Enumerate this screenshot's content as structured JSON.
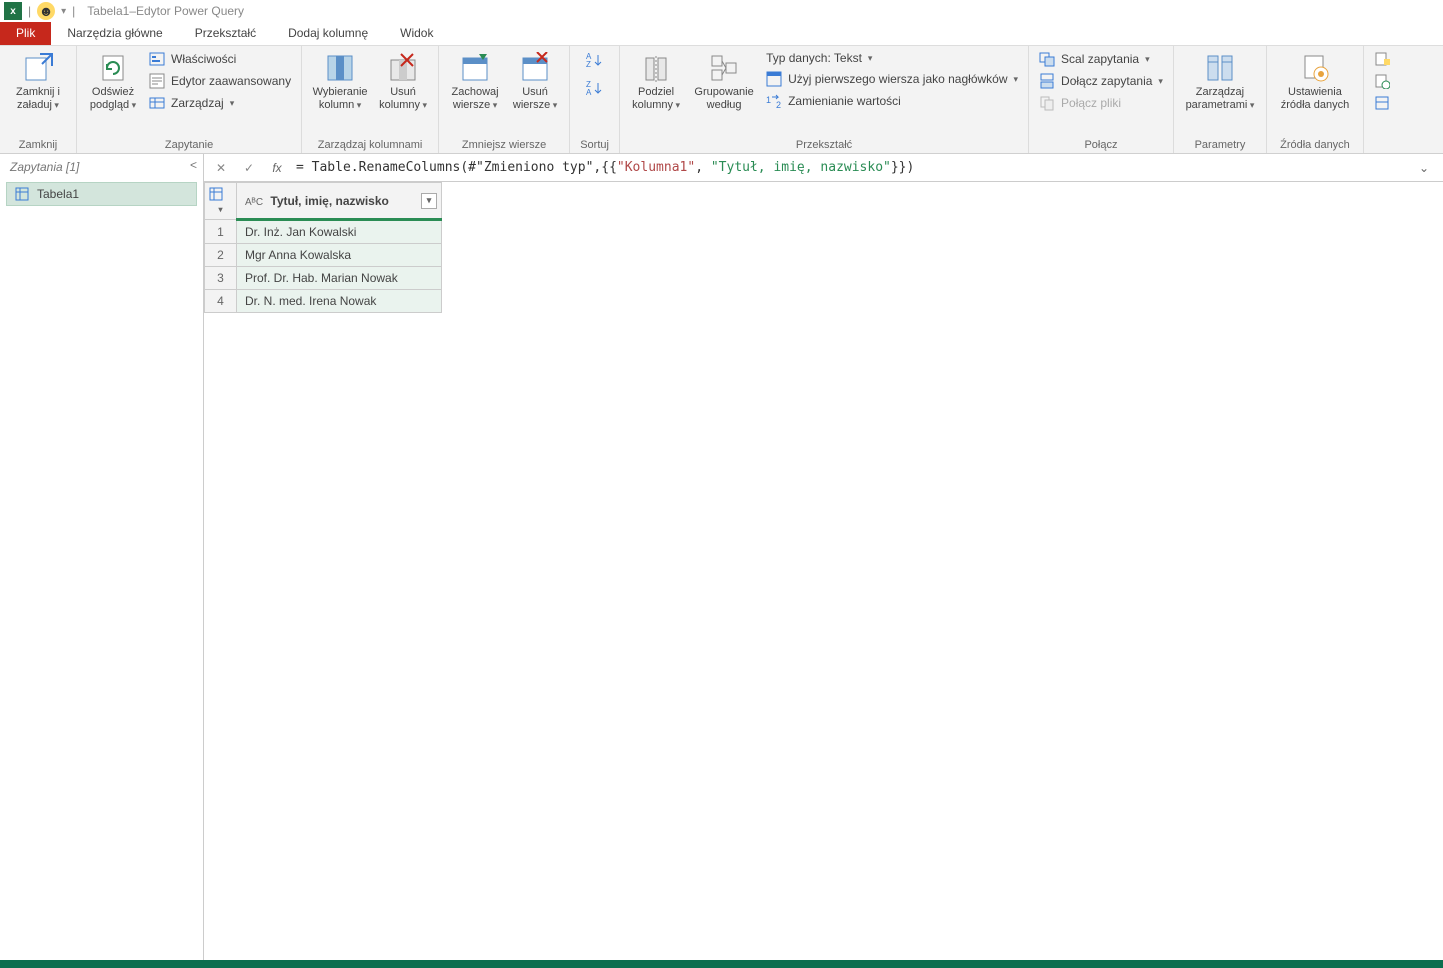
{
  "title": "Tabela1–Edytor Power Query",
  "qat_dd": "▾",
  "tabs": {
    "file": "Plik",
    "home": "Narzędzia główne",
    "transform": "Przekształć",
    "addcol": "Dodaj kolumnę",
    "view": "Widok"
  },
  "ribbon": {
    "close": {
      "btn": "Zamknij i\nzaładuj",
      "label": "Zamknij"
    },
    "query": {
      "refresh": "Odśwież\npodgląd",
      "props": "Właściwości",
      "advanced": "Edytor zaawansowany",
      "manage": "Zarządzaj",
      "label": "Zapytanie"
    },
    "cols": {
      "choose": "Wybieranie\nkolumn",
      "remove": "Usuń\nkolumny",
      "label": "Zarządzaj kolumnami"
    },
    "rows": {
      "keep": "Zachowaj\nwiersze",
      "remove": "Usuń\nwiersze",
      "label": "Zmniejsz wiersze"
    },
    "sort": {
      "label": "Sortuj"
    },
    "transform": {
      "split": "Podziel\nkolumny",
      "group": "Grupowanie\nwedług",
      "datatype": "Typ danych: Tekst",
      "firstrow": "Użyj pierwszego wiersza jako nagłówków",
      "replace": "Zamienianie wartości",
      "label": "Przekształć"
    },
    "combine": {
      "merge": "Scal zapytania",
      "append": "Dołącz zapytania",
      "combine_files": "Połącz pliki",
      "label": "Połącz"
    },
    "params": {
      "btn": "Zarządzaj\nparametrami",
      "label": "Parametry"
    },
    "ds": {
      "btn": "Ustawienia\nźródła danych",
      "label": "Źródła danych"
    }
  },
  "sidebar": {
    "header": "Zapytania [1]",
    "items": [
      {
        "name": "Tabela1"
      }
    ]
  },
  "formulabar": {
    "prefix": "= Table.RenameColumns(#",
    "arg1": "\"Zmieniono typ\"",
    "mid": ",{{",
    "s1": "\"Kolumna1\"",
    "comma": ", ",
    "s2": "\"Tytuł, imię, nazwisko\"",
    "suffix": "}})"
  },
  "table": {
    "coltype": "AᴮC",
    "colname": "Tytuł, imię, nazwisko",
    "rows": [
      {
        "n": "1",
        "v": "Dr. Inż. Jan Kowalski"
      },
      {
        "n": "2",
        "v": "Mgr Anna Kowalska"
      },
      {
        "n": "3",
        "v": "Prof. Dr. Hab. Marian Nowak"
      },
      {
        "n": "4",
        "v": "Dr. N. med. Irena Nowak"
      }
    ]
  }
}
